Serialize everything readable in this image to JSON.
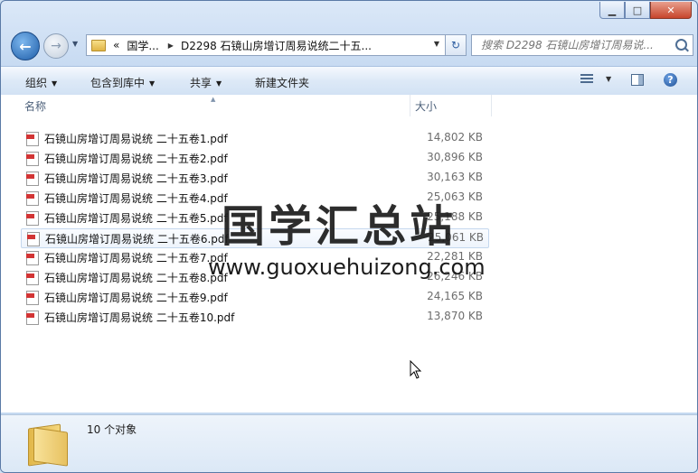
{
  "window": {
    "minimize_glyph": "▁",
    "maximize_glyph": "□",
    "close_glyph": "✕"
  },
  "nav": {
    "back_glyph": "←",
    "forward_glyph": "→",
    "breadcrumb_overflow": "«",
    "breadcrumb": [
      "国学...",
      "D2298 石镜山房增订周易说统二十五..."
    ],
    "refresh_glyph": "↻",
    "search_placeholder": "搜索 D2298 石镜山房增订周易说..."
  },
  "toolbar": {
    "organize": "组织",
    "include_in_library": "包含到库中",
    "share": "共享",
    "new_folder": "新建文件夹",
    "help_glyph": "?"
  },
  "columns": {
    "name": "名称",
    "size": "大小"
  },
  "files": [
    {
      "name": "石镜山房增订周易说统 二十五卷1.pdf",
      "size": "14,802 KB",
      "icon": "pdf-file-icon"
    },
    {
      "name": "石镜山房增订周易说统 二十五卷2.pdf",
      "size": "30,896 KB",
      "icon": "pdf-file-icon"
    },
    {
      "name": "石镜山房增订周易说统 二十五卷3.pdf",
      "size": "30,163 KB",
      "icon": "pdf-file-icon"
    },
    {
      "name": "石镜山房增订周易说统 二十五卷4.pdf",
      "size": "25,063 KB",
      "icon": "pdf-file-icon"
    },
    {
      "name": "石镜山房增订周易说统 二十五卷5.pdf",
      "size": "25,188 KB",
      "icon": "pdf-file-icon"
    },
    {
      "name": "石镜山房增订周易说统 二十五卷6.pdf",
      "size": "25,061 KB",
      "icon": "pdf-file-icon",
      "selected": true
    },
    {
      "name": "石镜山房增订周易说统 二十五卷7.pdf",
      "size": "22,281 KB",
      "icon": "pdf-file-icon"
    },
    {
      "name": "石镜山房增订周易说统 二十五卷8.pdf",
      "size": "26,246 KB",
      "icon": "pdf-file-icon"
    },
    {
      "name": "石镜山房增订周易说统 二十五卷9.pdf",
      "size": "24,165 KB",
      "icon": "pdf-file-icon"
    },
    {
      "name": "石镜山房增订周易说统 二十五卷10.pdf",
      "size": "13,870 KB",
      "icon": "pdf-file-icon"
    }
  ],
  "watermark": {
    "title": "国学汇总站",
    "url": "www.guoxuehuizong.com"
  },
  "status": {
    "count": "10 个对象"
  },
  "colors": {
    "pdf_red": "#d23434",
    "selection_border": "#c4d7ee",
    "toolbar_bg": "#dde9f7"
  }
}
